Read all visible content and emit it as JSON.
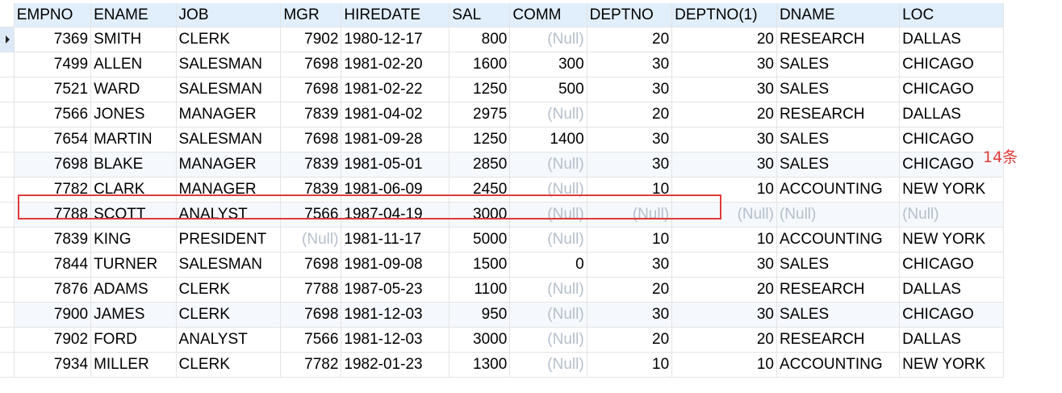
{
  "grid": {
    "columns": [
      "EMPNO",
      "ENAME",
      "JOB",
      "MGR",
      "HIREDATE",
      "SAL",
      "COMM",
      "DEPTNO",
      "DEPTNO(1)",
      "DNAME",
      "LOC"
    ],
    "null_text": "(Null)",
    "rows": [
      [
        "7369",
        "SMITH",
        "CLERK",
        "7902",
        "1980-12-17",
        "800",
        null,
        "20",
        "20",
        "RESEARCH",
        "DALLAS"
      ],
      [
        "7499",
        "ALLEN",
        "SALESMAN",
        "7698",
        "1981-02-20",
        "1600",
        "300",
        "30",
        "30",
        "SALES",
        "CHICAGO"
      ],
      [
        "7521",
        "WARD",
        "SALESMAN",
        "7698",
        "1981-02-22",
        "1250",
        "500",
        "30",
        "30",
        "SALES",
        "CHICAGO"
      ],
      [
        "7566",
        "JONES",
        "MANAGER",
        "7839",
        "1981-04-02",
        "2975",
        null,
        "20",
        "20",
        "RESEARCH",
        "DALLAS"
      ],
      [
        "7654",
        "MARTIN",
        "SALESMAN",
        "7698",
        "1981-09-28",
        "1250",
        "1400",
        "30",
        "30",
        "SALES",
        "CHICAGO"
      ],
      [
        "7698",
        "BLAKE",
        "MANAGER",
        "7839",
        "1981-05-01",
        "2850",
        null,
        "30",
        "30",
        "SALES",
        "CHICAGO"
      ],
      [
        "7782",
        "CLARK",
        "MANAGER",
        "7839",
        "1981-06-09",
        "2450",
        null,
        "10",
        "10",
        "ACCOUNTING",
        "NEW YORK"
      ],
      [
        "7788",
        "SCOTT",
        "ANALYST",
        "7566",
        "1987-04-19",
        "3000",
        null,
        null,
        null,
        null,
        null
      ],
      [
        "7839",
        "KING",
        "PRESIDENT",
        null,
        "1981-11-17",
        "5000",
        null,
        "10",
        "10",
        "ACCOUNTING",
        "NEW YORK"
      ],
      [
        "7844",
        "TURNER",
        "SALESMAN",
        "7698",
        "1981-09-08",
        "1500",
        "0",
        "30",
        "30",
        "SALES",
        "CHICAGO"
      ],
      [
        "7876",
        "ADAMS",
        "CLERK",
        "7788",
        "1987-05-23",
        "1100",
        null,
        "20",
        "20",
        "RESEARCH",
        "DALLAS"
      ],
      [
        "7900",
        "JAMES",
        "CLERK",
        "7698",
        "1981-12-03",
        "950",
        null,
        "30",
        "30",
        "SALES",
        "CHICAGO"
      ],
      [
        "7902",
        "FORD",
        "ANALYST",
        "7566",
        "1981-12-03",
        "3000",
        null,
        "20",
        "20",
        "RESEARCH",
        "DALLAS"
      ],
      [
        "7934",
        "MILLER",
        "CLERK",
        "7782",
        "1982-01-23",
        "1300",
        null,
        "10",
        "10",
        "ACCOUNTING",
        "NEW YORK"
      ]
    ],
    "selected_row": 0
  },
  "annotation": {
    "text": "14条",
    "color": "#e03a3a"
  },
  "colors": {
    "header_bg": "#e1eefb",
    "null_text": "#b4bfcc",
    "highlight_border": "#e03a3a"
  }
}
